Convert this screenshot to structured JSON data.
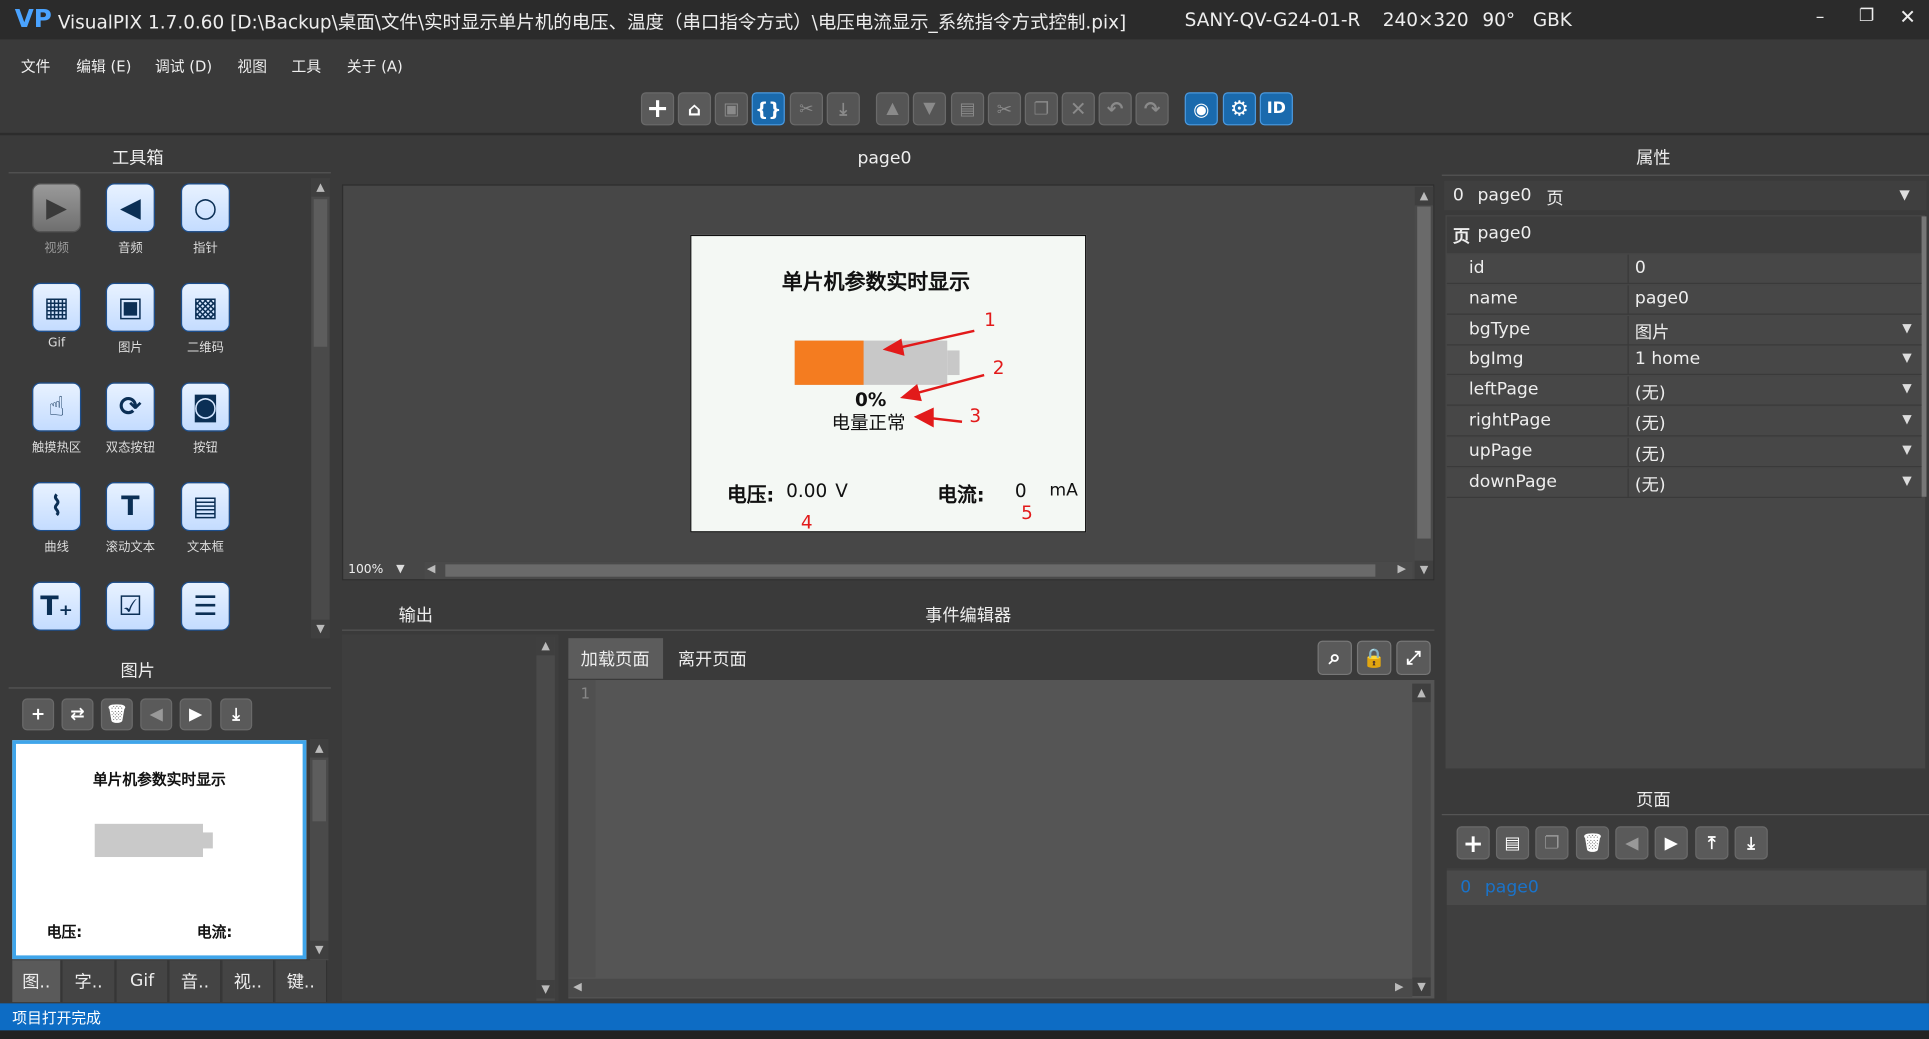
{
  "titlebar": {
    "logo": "VP",
    "title": "VisualPIX 1.7.0.60 [D:\\Backup\\桌面\\文件\\实时显示单片机的电压、温度（串口指令方式）\\电压电流显示_系统指令方式控制.pix]",
    "device": "SANY-QV-G24-01-R",
    "resolution": "240×320",
    "rotation": "90°",
    "encoding": "GBK"
  },
  "menu": [
    "文件",
    "编辑 (E)",
    "调试 (D)",
    "视图",
    "工具",
    "关于 (A)"
  ],
  "toolbox": {
    "title": "工具箱",
    "items": [
      {
        "label": "视频",
        "icon": "video-icon",
        "glyph": "▶"
      },
      {
        "label": "音频",
        "icon": "audio-icon",
        "glyph": "◀"
      },
      {
        "label": "指针",
        "icon": "pointer-icon",
        "glyph": "○"
      },
      {
        "label": "Gif",
        "icon": "gif-icon",
        "glyph": "▦"
      },
      {
        "label": "图片",
        "icon": "picture-icon",
        "glyph": "▣"
      },
      {
        "label": "二维码",
        "icon": "qrcode-icon",
        "glyph": "▩"
      },
      {
        "label": "触摸热区",
        "icon": "touch-icon",
        "glyph": "☝"
      },
      {
        "label": "双态按钮",
        "icon": "toggle-button-icon",
        "glyph": "⟳"
      },
      {
        "label": "按钮",
        "icon": "button-icon",
        "glyph": "◙"
      },
      {
        "label": "曲线",
        "icon": "curve-icon",
        "glyph": "⌇"
      },
      {
        "label": "滚动文本",
        "icon": "scroll-text-icon",
        "glyph": "T"
      },
      {
        "label": "文本框",
        "icon": "textbox-icon",
        "glyph": "▤"
      },
      {
        "label": "",
        "icon": "text-add-icon",
        "glyph": "T₊"
      },
      {
        "label": "",
        "icon": "checkbox-icon",
        "glyph": "☑"
      },
      {
        "label": "",
        "icon": "list-icon",
        "glyph": "☰"
      }
    ]
  },
  "images_panel": {
    "title": "图片",
    "thumb_title": "单片机参数实时显示",
    "thumb_voltage": "电压:",
    "thumb_current": "电流:"
  },
  "bottom_tabs": [
    "图..",
    "字..",
    "Gif",
    "音..",
    "视..",
    "键.."
  ],
  "canvas": {
    "tab": "page0",
    "zoom": "100%",
    "screen": {
      "title": "单片机参数实时显示",
      "percent": "0%",
      "status": "电量正常",
      "voltage_label": "电压:",
      "voltage_value": "0.00",
      "voltage_unit": "V",
      "current_label": "电流:",
      "current_value": "0",
      "current_unit": "mA",
      "battery_fill_fraction": 0.45
    },
    "annotations": [
      "1",
      "2",
      "3",
      "4",
      "5"
    ]
  },
  "output": {
    "title": "输出"
  },
  "event_editor": {
    "title": "事件编辑器",
    "tabs": [
      "加载页面",
      "离开页面"
    ],
    "line_number": "1"
  },
  "properties": {
    "title": "属性",
    "selector": {
      "index": "0",
      "name": "page0",
      "type": "页"
    },
    "group": "页",
    "group_name": "page0",
    "rows": [
      {
        "key": "id",
        "value": "0",
        "dropdown": false
      },
      {
        "key": "name",
        "value": "page0",
        "dropdown": false
      },
      {
        "key": "bgType",
        "value": "图片",
        "dropdown": true
      },
      {
        "key": "bgImg",
        "value": "1 home",
        "dropdown": true
      },
      {
        "key": "leftPage",
        "value": "(无)",
        "dropdown": true
      },
      {
        "key": "rightPage",
        "value": "(无)",
        "dropdown": true
      },
      {
        "key": "upPage",
        "value": "(无)",
        "dropdown": true
      },
      {
        "key": "downPage",
        "value": "(无)",
        "dropdown": true
      }
    ]
  },
  "pages": {
    "title": "页面",
    "items": [
      {
        "index": "0",
        "name": "page0"
      }
    ]
  },
  "statusbar": {
    "text": "项目打开完成"
  },
  "colors": {
    "accent": "#1a6aad",
    "orange": "#f47c20",
    "statusbar": "#0d6cc4",
    "annotation": "#e21a1a"
  }
}
